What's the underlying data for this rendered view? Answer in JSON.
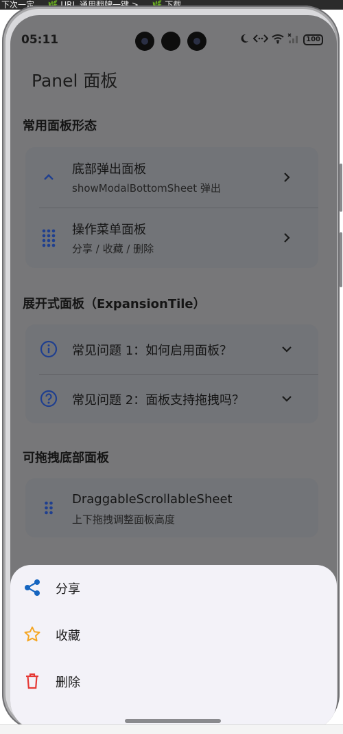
{
  "topbar": {
    "text": "下次一定 … 🌿 URL 通用翻牌一键 > … 🌿 下载…"
  },
  "status": {
    "time": "05:11",
    "battery": "100"
  },
  "page": {
    "title": "Panel 面板"
  },
  "sections": {
    "common": {
      "title": "常用面板形态",
      "items": [
        {
          "title": "底部弹出面板",
          "subtitle": "showModalBottomSheet 弹出",
          "icon": "chevron-up-icon",
          "trailing": "chevron-right-icon"
        },
        {
          "title": "操作菜单面板",
          "subtitle": "分享 / 收藏 / 删除",
          "icon": "dots-grid-icon",
          "trailing": "chevron-right-icon"
        }
      ]
    },
    "expansion": {
      "title": "展开式面板（ExpansionTile）",
      "items": [
        {
          "title": "常见问题 1：如何启用面板？",
          "icon": "info-circle-icon",
          "trailing": "chevron-down-icon"
        },
        {
          "title": "常见问题 2：面板支持拖拽吗？",
          "icon": "help-circle-icon",
          "trailing": "chevron-down-icon"
        }
      ]
    },
    "draggable": {
      "title": "可拖拽底部面板",
      "items": [
        {
          "title": "DraggableScrollableSheet",
          "subtitle": "上下拖拽调整面板高度",
          "icon": "drag-handle-icon"
        }
      ]
    }
  },
  "sheet": {
    "items": [
      {
        "label": "分享",
        "icon": "share-icon",
        "color": "#1565c0"
      },
      {
        "label": "收藏",
        "icon": "star-outline-icon",
        "color": "#f5a623"
      },
      {
        "label": "删除",
        "icon": "trash-icon",
        "color": "#e53935"
      }
    ]
  },
  "colors": {
    "accent": "#1f3f8f",
    "scrim": "#777779",
    "sheet_bg": "#f3f2f8"
  }
}
